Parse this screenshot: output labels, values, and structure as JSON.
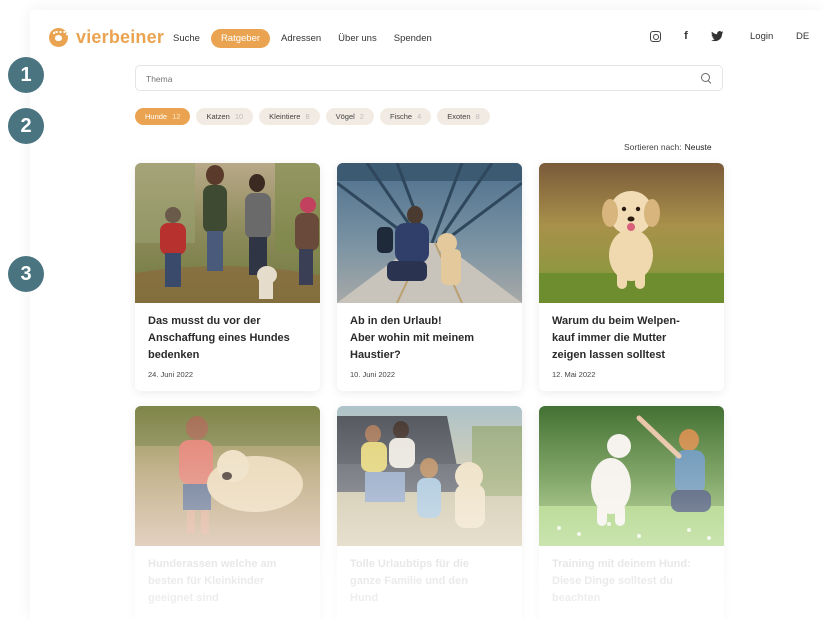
{
  "header": {
    "logo_text": "vierbeiner",
    "nav": [
      {
        "label": "Suche",
        "active": false
      },
      {
        "label": "Ratgeber",
        "active": true
      },
      {
        "label": "Adressen",
        "active": false
      },
      {
        "label": "Über uns",
        "active": false
      },
      {
        "label": "Spenden",
        "active": false
      }
    ],
    "social_facebook": "f",
    "social_twitter": "🐦",
    "login_label": "Login",
    "language": "DE"
  },
  "search": {
    "placeholder": "Thema"
  },
  "filters": [
    {
      "label": "Hunde",
      "count": "12",
      "active": true
    },
    {
      "label": "Katzen",
      "count": "10",
      "active": false
    },
    {
      "label": "Kleintiere",
      "count": "8",
      "active": false
    },
    {
      "label": "Vögel",
      "count": "2",
      "active": false
    },
    {
      "label": "Fische",
      "count": "4",
      "active": false
    },
    {
      "label": "Exoten",
      "count": "8",
      "active": false
    }
  ],
  "sort": {
    "label": "Sortieren nach:",
    "value": "Neuste"
  },
  "cards": [
    {
      "title": "Das musst du vor der\nAnschaffung eines Hundes\nbedenken",
      "date": "24. Juni 2022"
    },
    {
      "title": "Ab in den Urlaub!\nAber wohin mit meinem\nHaustier?",
      "date": "10. Juni 2022"
    },
    {
      "title": "Warum du beim Welpen-\nkauf immer die Mutter\nzeigen lassen solltest",
      "date": "12. Mai 2022"
    },
    {
      "title": "Hunderassen welche am\nbesten für Kleinkinder\ngeeignet sind",
      "date": ""
    },
    {
      "title": "Tolle Urlaubtips für die\nganze Familie und den\nHund",
      "date": ""
    },
    {
      "title": "Training mit deinem Hund:\nDiese Dinge solltest du\nbeachten",
      "date": ""
    }
  ],
  "steps": [
    "1",
    "2",
    "3"
  ],
  "colors": {
    "accent": "#eaa451",
    "chip_bg": "#f2ebe3",
    "step_marker": "#4a7480"
  }
}
